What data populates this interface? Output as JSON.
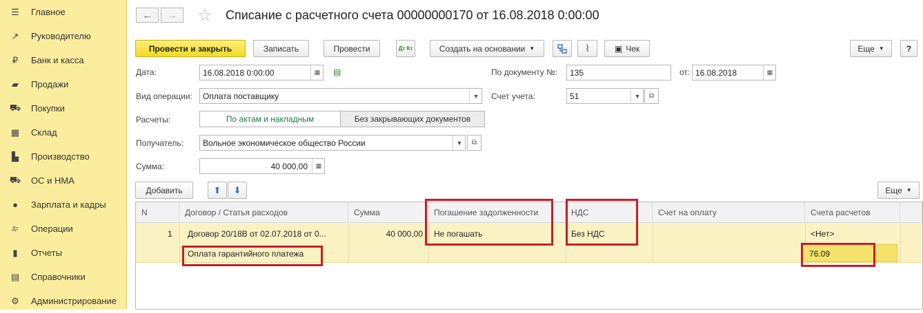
{
  "sidebar": {
    "items": [
      {
        "label": "Главное",
        "icon": "menu-icon",
        "glyph": "☰"
      },
      {
        "label": "Руководителю",
        "icon": "trend-icon",
        "glyph": "↗"
      },
      {
        "label": "Банк и касса",
        "icon": "ruble-icon",
        "glyph": "₽"
      },
      {
        "label": "Продажи",
        "icon": "bag-icon",
        "glyph": "▰"
      },
      {
        "label": "Покупки",
        "icon": "cart-icon",
        "glyph": "⛟"
      },
      {
        "label": "Склад",
        "icon": "warehouse-icon",
        "glyph": "▦"
      },
      {
        "label": "Производство",
        "icon": "factory-icon",
        "glyph": "▙"
      },
      {
        "label": "ОС и НМА",
        "icon": "truck-icon",
        "glyph": "⛟"
      },
      {
        "label": "Зарплата и кадры",
        "icon": "person-icon",
        "glyph": "●"
      },
      {
        "label": "Операции",
        "icon": "dtkt-icon",
        "glyph": "Дт"
      },
      {
        "label": "Отчеты",
        "icon": "bar-chart-icon",
        "glyph": "▮"
      },
      {
        "label": "Справочники",
        "icon": "book-icon",
        "glyph": "▤"
      },
      {
        "label": "Администрирование",
        "icon": "gear-icon",
        "glyph": "⚙"
      }
    ]
  },
  "header": {
    "title": "Списание с расчетного счета 00000000170 от 16.08.2018 0:00:00",
    "back_glyph": "←",
    "forward_glyph": "→",
    "star_glyph": "☆"
  },
  "toolbar": {
    "post_close": "Провести и закрыть",
    "save": "Записать",
    "post": "Провести",
    "create_based": "Создать на основании",
    "check": "Чек",
    "more": "Еще",
    "help": "?",
    "dtkt": "Дт Кт"
  },
  "form": {
    "date_label": "Дата:",
    "date_value": "16.08.2018  0:00:00",
    "doc_no_label": "По документу №:",
    "doc_no_value": "135",
    "from_label": "от:",
    "from_value": "16.08.2018",
    "op_type_label": "Вид операции:",
    "op_type_value": "Оплата поставщику",
    "account_label": "Счет учета:",
    "account_value": "51",
    "settlements_label": "Расчеты:",
    "settlement_opt1": "По актам и накладным",
    "settlement_opt2": "Без закрывающих документов",
    "recipient_label": "Получатель:",
    "recipient_value": "Вольное экономическое общество России",
    "sum_label": "Сумма:",
    "sum_value": "40 000,00"
  },
  "table_toolbar": {
    "add": "Добавить",
    "more": "Еще"
  },
  "table": {
    "headers": [
      "N",
      "Договор / Статья расходов",
      "Сумма",
      "Погашение задолженности",
      "НДС",
      "Счет на оплату",
      "Счета расчетов"
    ],
    "rows": [
      {
        "n": "1",
        "contract": "Договор 20/18В от 02.07.2018 от 0...",
        "expense": "Оплата гарантийного платежа",
        "sum": "40 000,00",
        "repayment": "Не погашать",
        "vat": "Без НДС",
        "invoice": "",
        "account1": "<Нет>",
        "account2": "76.09"
      }
    ]
  },
  "colors": {
    "sidebar_bg": "#fbed9e",
    "primary_button": "#f3d926",
    "highlight": "#c41e2a",
    "row_bg": "#fbf2c4",
    "active_toggle_text": "#1e7a3a"
  }
}
